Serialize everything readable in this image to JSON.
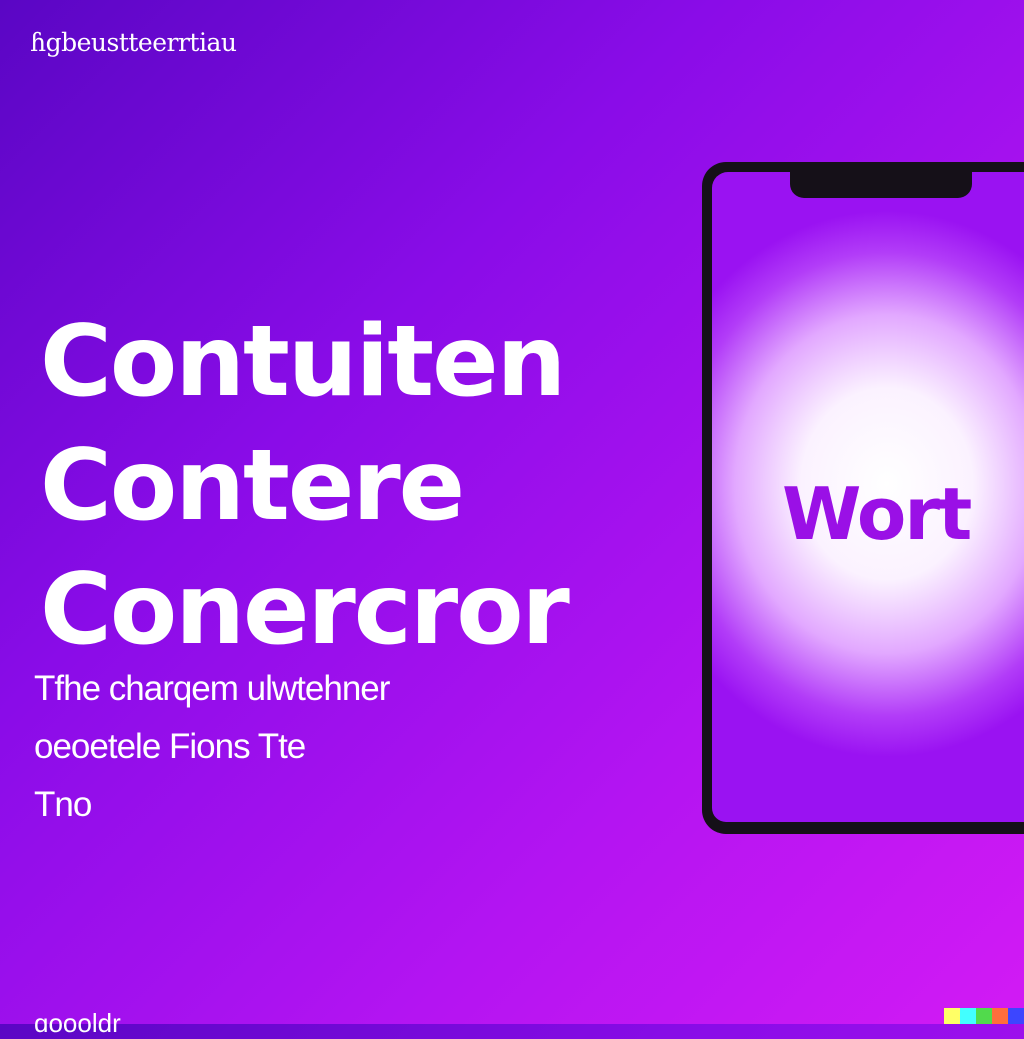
{
  "brand": "ɦgbeustteerrtiau",
  "headline": {
    "line1": "Contuiten",
    "line2": "Contere",
    "line3": "Conercror"
  },
  "description": {
    "line1": "Tfhe charqem ulwtehner",
    "line2": "oeoetele Fions Tte",
    "line3": "Tno"
  },
  "footer": "ɑoooldr",
  "phone": {
    "screen_word": "Wort"
  },
  "colors": {
    "background_start": "#5a06c4",
    "background_end": "#d21af4",
    "screen_word": "#9a10e6",
    "watermark": [
      "#ffff66",
      "#42ffff",
      "#51da4c",
      "#ff6e3c",
      "#3c46ff"
    ]
  }
}
